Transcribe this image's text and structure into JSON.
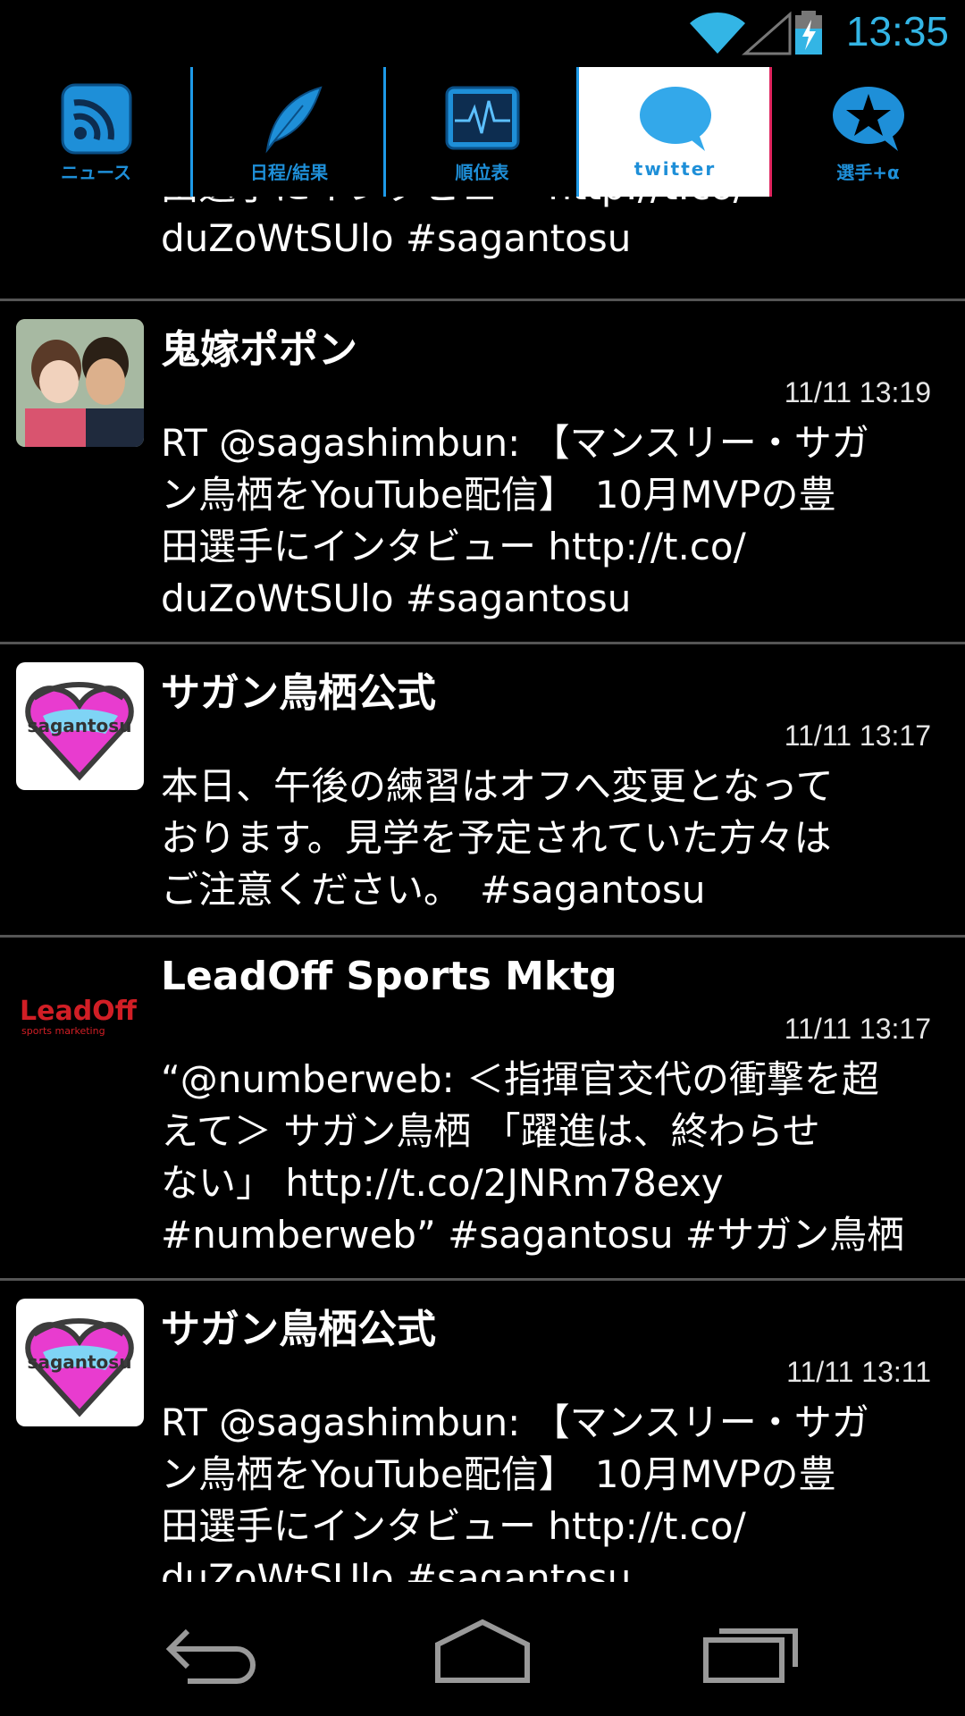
{
  "status_bar": {
    "time": "13:35"
  },
  "tabs": [
    {
      "label": "ニュース",
      "icon": "rss-icon"
    },
    {
      "label": "日程/結果",
      "icon": "quill-icon"
    },
    {
      "label": "順位表",
      "icon": "pulse-chart-icon"
    },
    {
      "label": "twitter",
      "icon": "speech-bubble-icon",
      "active": true
    },
    {
      "label": "選手+α",
      "icon": "star-bubble-icon"
    }
  ],
  "feed": {
    "partial_top_text": "田選手にインタビュー http://t.co/\nduZoWtSUlo #sagantosu",
    "tweets": [
      {
        "name": "鬼嫁ポポン",
        "time": "11/11 13:19",
        "text": "RT @sagashimbun: 【マンスリー・サガ\nン鳥栖をYouTube配信】　10月MVPの豊\n田選手にインタビュー http://t.co/\nduZoWtSUlo #sagantosu",
        "avatar": "user-photo-avatar"
      },
      {
        "name": "サガン鳥栖公式",
        "time": "11/11 13:17",
        "text": "本日、午後の練習はオフへ変更となって\nおります。見学を予定されていた方々は\nご注意ください。　#sagantosu",
        "avatar": "sagantosu-logo-avatar"
      },
      {
        "name": "LeadOff Sports Mktg",
        "time": "11/11 13:17",
        "text": "“@numberweb: ＜指揮官交代の衝撃を超\nえて＞ サガン鳥栖 「躍進は、終わらせ\nない」 http://t.co/2JNRm78exy\n#numberweb” #sagantosu #サガン鳥栖",
        "avatar": "leadoff-logo-avatar"
      },
      {
        "name": "サガン鳥栖公式",
        "time": "11/11 13:11",
        "text": "RT @sagashimbun: 【マンスリー・サガ\nン鳥栖をYouTube配信】　10月MVPの豊\n田選手にインタビュー http://t.co/\nduZoWtSUlo #sagantosu",
        "avatar": "sagantosu-logo-avatar"
      }
    ]
  },
  "colors": {
    "accent": "#33b5e5",
    "tab_blue": "#1e8fd8"
  }
}
